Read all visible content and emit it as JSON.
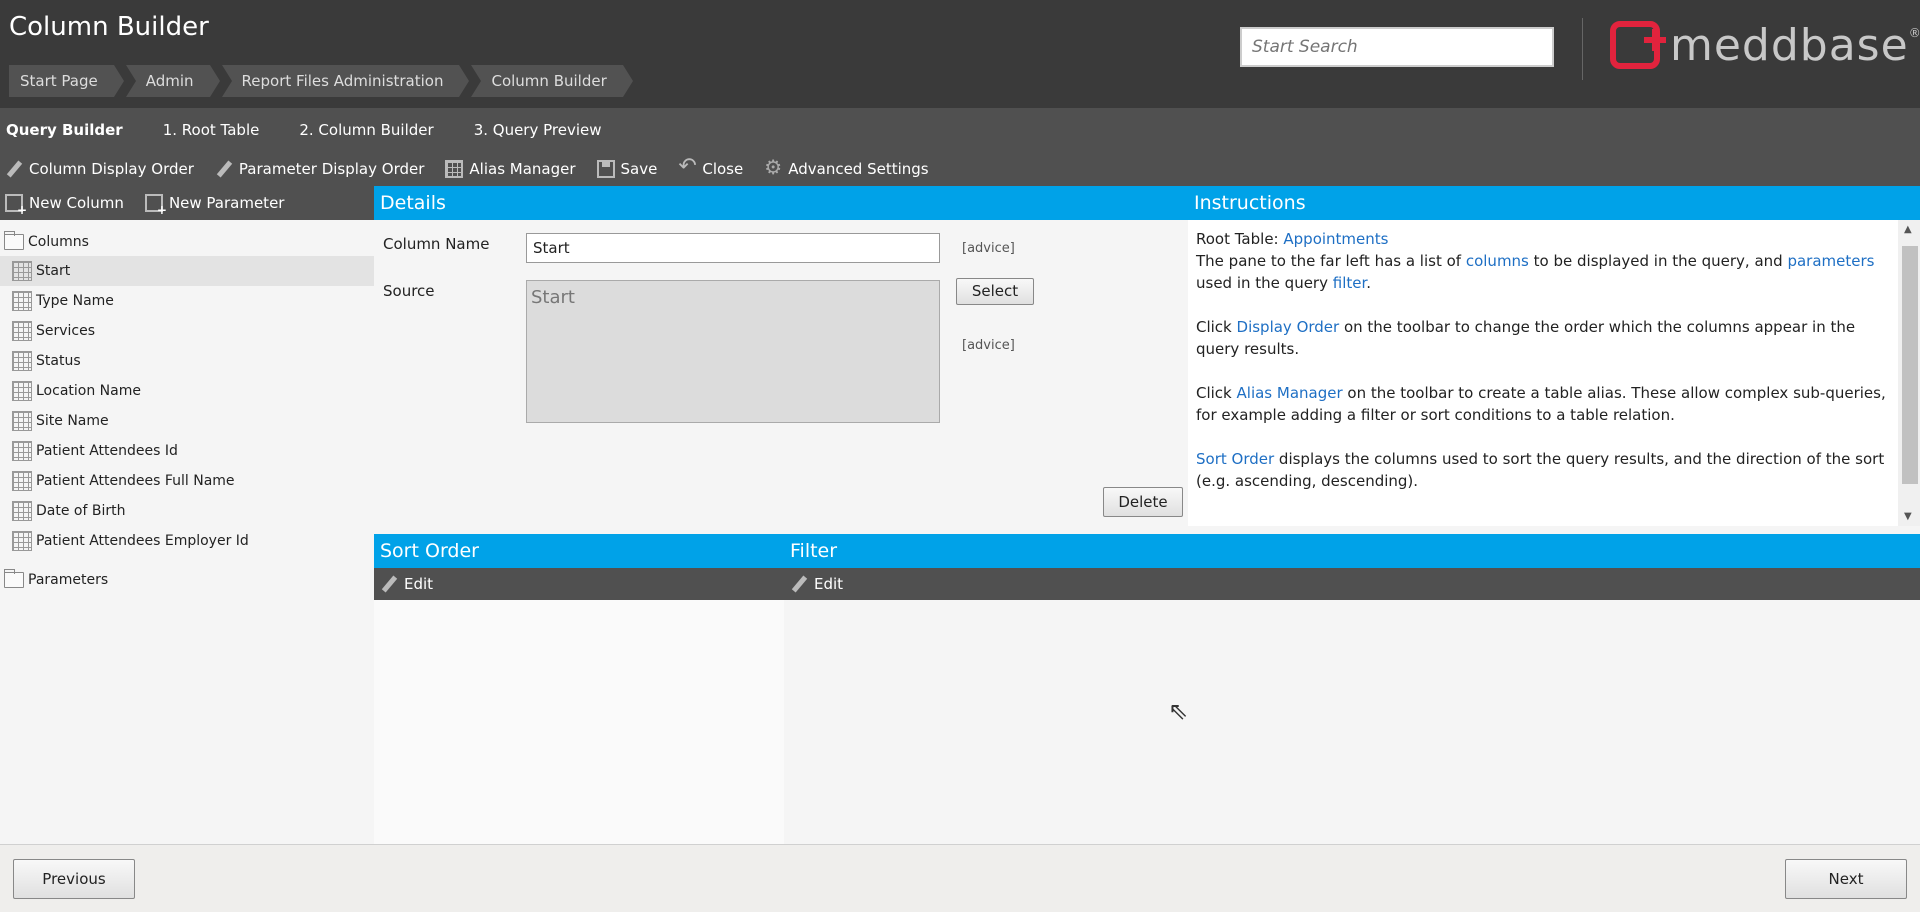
{
  "header": {
    "title": "Column Builder",
    "breadcrumbs": [
      "Start Page",
      "Admin",
      "Report Files Administration",
      "Column Builder"
    ],
    "search_placeholder": "Start Search",
    "logo_text": "meddbase",
    "logo_mark": "®"
  },
  "steps": {
    "current": "Query Builder",
    "items": [
      "1. Root Table",
      "2. Column Builder",
      "3. Query Preview"
    ]
  },
  "toolbar": {
    "column_display_order": "Column Display Order",
    "parameter_display_order": "Parameter Display Order",
    "alias_manager": "Alias Manager",
    "save": "Save",
    "close": "Close",
    "advanced_settings": "Advanced Settings"
  },
  "left_toolbar": {
    "new_column": "New Column",
    "new_parameter": "New Parameter"
  },
  "tree": {
    "columns_label": "Columns",
    "columns": [
      "Start",
      "Type Name",
      "Services",
      "Status",
      "Location Name",
      "Site Name",
      "Patient Attendees Id",
      "Patient Attendees Full Name",
      "Date of Birth",
      "Patient Attendees Employer Id"
    ],
    "selected_index": 0,
    "parameters_label": "Parameters"
  },
  "details": {
    "header": "Details",
    "column_name_label": "Column Name",
    "column_name_value": "Start",
    "advice_label": "[advice]",
    "source_label": "Source",
    "source_value": "Start",
    "select_button": "Select",
    "delete_button": "Delete"
  },
  "instructions": {
    "header": "Instructions",
    "root_table_label": "Root Table:",
    "root_table_value": "Appointments",
    "p1_a": "The pane to the far left has a list of ",
    "p1_link1": "columns",
    "p1_b": " to be displayed in the query, and ",
    "p1_link2": "parameters",
    "p1_c": " used in the query ",
    "p1_link3": "filter",
    "p1_d": ".",
    "p2_a": "Click ",
    "p2_link": "Display Order",
    "p2_b": " on the toolbar to change the order which the columns appear in the query results.",
    "p3_a": "Click ",
    "p3_link": "Alias Manager",
    "p3_b": " on the toolbar to create a table alias. These allow complex sub-queries, for example adding a filter or sort conditions to a table relation.",
    "p4_link": "Sort Order",
    "p4_b": " displays the columns used to sort the query results, and the direction of the sort (e.g. ascending, descending)."
  },
  "sort_order": {
    "header": "Sort Order",
    "edit": "Edit"
  },
  "filter": {
    "header": "Filter",
    "edit": "Edit"
  },
  "footer": {
    "previous": "Previous",
    "next": "Next"
  },
  "colors": {
    "accent": "#00a2e8",
    "header_bg": "#3a3a3a",
    "toolbar_bg": "#505050",
    "logo_red": "#e2233d",
    "link": "#1e6fc4"
  }
}
